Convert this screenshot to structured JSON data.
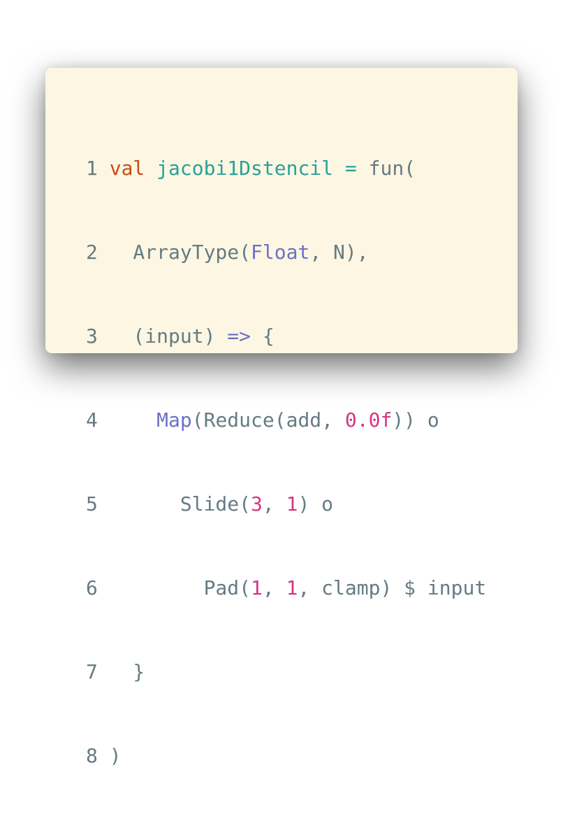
{
  "code_block": {
    "lines": [
      {
        "number": "1",
        "tokens": [
          {
            "text": "val",
            "kind": "keyword"
          },
          {
            "text": " ",
            "kind": "plain"
          },
          {
            "text": "jacobi1Dstencil",
            "kind": "function-name"
          },
          {
            "text": " ",
            "kind": "plain"
          },
          {
            "text": "=",
            "kind": "function-name"
          },
          {
            "text": " fun(",
            "kind": "plain"
          }
        ]
      },
      {
        "number": "2",
        "tokens": [
          {
            "text": "  ArrayType(",
            "kind": "plain"
          },
          {
            "text": "Float",
            "kind": "type"
          },
          {
            "text": ", N),",
            "kind": "plain"
          }
        ]
      },
      {
        "number": "3",
        "tokens": [
          {
            "text": "  (input) ",
            "kind": "plain"
          },
          {
            "text": "=>",
            "kind": "type"
          },
          {
            "text": " {",
            "kind": "plain"
          }
        ]
      },
      {
        "number": "4",
        "tokens": [
          {
            "text": "    ",
            "kind": "plain"
          },
          {
            "text": "Map",
            "kind": "type"
          },
          {
            "text": "(Reduce(add, ",
            "kind": "plain"
          },
          {
            "text": "0.0f",
            "kind": "number"
          },
          {
            "text": ")) o",
            "kind": "plain"
          }
        ]
      },
      {
        "number": "5",
        "tokens": [
          {
            "text": "      Slide(",
            "kind": "plain"
          },
          {
            "text": "3",
            "kind": "number"
          },
          {
            "text": ", ",
            "kind": "plain"
          },
          {
            "text": "1",
            "kind": "number"
          },
          {
            "text": ") o",
            "kind": "plain"
          }
        ]
      },
      {
        "number": "6",
        "tokens": [
          {
            "text": "        Pad(",
            "kind": "plain"
          },
          {
            "text": "1",
            "kind": "number"
          },
          {
            "text": ", ",
            "kind": "plain"
          },
          {
            "text": "1",
            "kind": "number"
          },
          {
            "text": ", clamp) $ input",
            "kind": "plain"
          }
        ]
      },
      {
        "number": "7",
        "tokens": [
          {
            "text": "  }",
            "kind": "plain"
          }
        ]
      },
      {
        "number": "8",
        "tokens": [
          {
            "text": ")",
            "kind": "plain"
          }
        ]
      }
    ]
  },
  "colors": {
    "background": "#fdf6e3",
    "plain": "#657b83",
    "keyword": "#cb4b16",
    "function_name": "#2aa198",
    "type": "#6c71c4",
    "number": "#d33682"
  }
}
